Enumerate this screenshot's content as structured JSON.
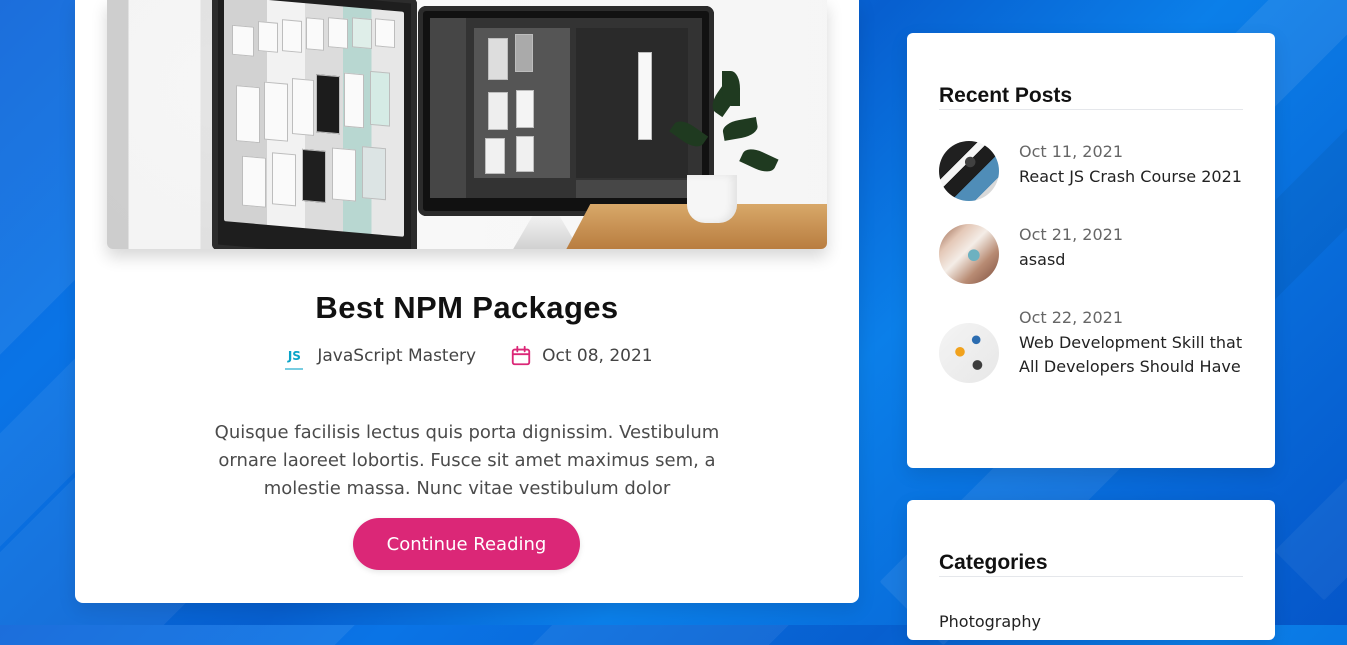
{
  "post": {
    "title": "Best NPM Packages",
    "author": "JavaScript Mastery",
    "author_logo": "JS",
    "date": "Oct 08, 2021",
    "excerpt": "Quisque facilisis lectus quis porta dignissim. Vestibulum ornare laoreet lobortis. Fusce sit amet maximus sem, a molestie massa. Nunc vitae vestibulum dolor",
    "cta_label": "Continue Reading",
    "icons": {
      "author": "javascript-logo-icon",
      "date": "calendar-icon"
    }
  },
  "sidebar": {
    "recent_posts": {
      "title": "Recent Posts",
      "items": [
        {
          "date": "Oct 11, 2021",
          "title": "React JS Crash Course 2021"
        },
        {
          "date": "Oct 21, 2021",
          "title": "asasd"
        },
        {
          "date": "Oct 22, 2021",
          "title": "Web Development Skill that All Developers Should Have"
        }
      ]
    },
    "categories": {
      "title": "Categories",
      "items": [
        "Photography"
      ]
    }
  },
  "colors": {
    "accent": "#db2777",
    "background": "#0a6fe3",
    "card": "#ffffff"
  }
}
